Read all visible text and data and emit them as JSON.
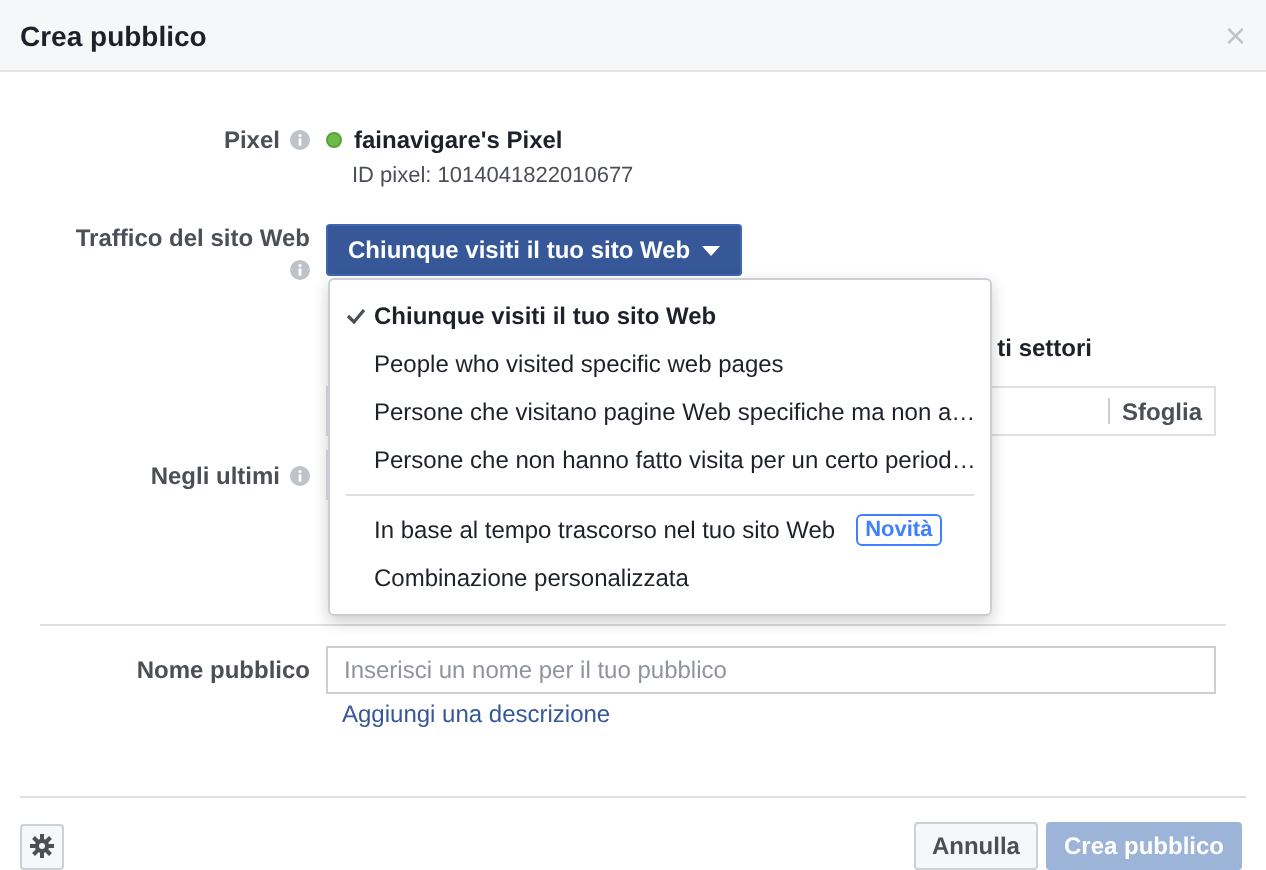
{
  "dialog": {
    "title": "Crea pubblico",
    "close": "×"
  },
  "pixel": {
    "label": "Pixel",
    "name": "fainavigare's Pixel",
    "id": "ID pixel: 1014041822010677"
  },
  "traffic": {
    "label": "Traffico del sito Web",
    "button": "Chiunque visiti il tuo sito Web",
    "expanded": true,
    "menu_groups": [
      [
        {
          "label": "Chiunque visiti il tuo sito Web",
          "selected": true
        },
        {
          "label": "People who visited specific web pages",
          "selected": false
        },
        {
          "label": "Persone che visitano pagine Web specifiche ma non a…",
          "selected": false
        },
        {
          "label": "Persone che non hanno fatto visita per un certo period…",
          "selected": false
        }
      ],
      [
        {
          "label": "In base al tempo trascorso nel tuo sito Web",
          "badge": "Novità",
          "selected": false
        },
        {
          "label": "Combinazione personalizzata",
          "selected": false
        }
      ]
    ]
  },
  "covered": {
    "text": "ti settori",
    "browse_button": "Sfoglia"
  },
  "period": {
    "label": "Negli ultimi"
  },
  "audience_name": {
    "label": "Nome pubblico",
    "placeholder": "Inserisci un nome per il tuo pubblico",
    "link": "Aggiungi una descrizione"
  },
  "footer": {
    "cancel": "Annulla",
    "create": "Crea pubblico",
    "create_disabled": true
  }
}
